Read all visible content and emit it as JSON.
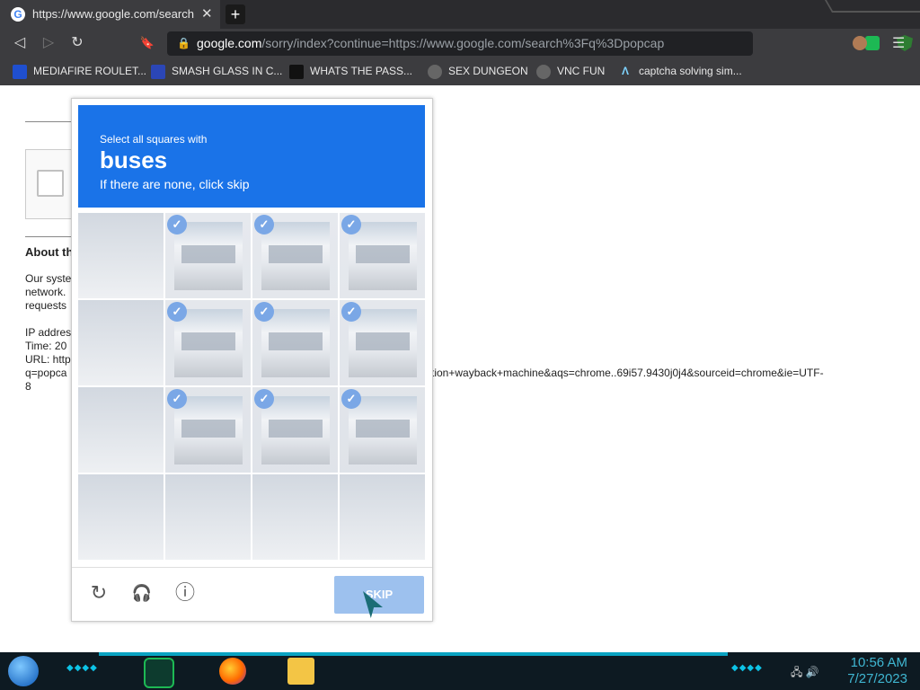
{
  "browser": {
    "tab": {
      "title": "https://www.google.com/search?q",
      "favicon": "G",
      "close": "✕"
    },
    "new_tab": "+",
    "toolbar": {
      "back": "◁",
      "forward": "▷",
      "reload": "↻",
      "bookmark": "🔖",
      "menu": "☰"
    },
    "omnibox": {
      "lock": "🔒",
      "host": "google.com",
      "path": "/sorry/index?continue=https://www.google.com/search%3Fq%3Dpopcap..."
    }
  },
  "bookmarks": [
    {
      "label": "MEDIAFIRE ROULET...",
      "icon": "mediafire-icon",
      "color": "#1f4fcf"
    },
    {
      "label": "SMASH GLASS IN C...",
      "icon": "smash-icon",
      "color": "#2b46b6"
    },
    {
      "label": "WHATS THE PASS...",
      "icon": "pass-icon",
      "color": "#111111"
    },
    {
      "label": "SEX DUNGEON",
      "icon": "dungeon-icon",
      "color": "#666666"
    },
    {
      "label": "VNC FUN",
      "icon": "vnc-icon",
      "color": "#666666"
    },
    {
      "label": "captcha solving sim...",
      "icon": "captcha-icon",
      "color": "#3c3c3f"
    }
  ],
  "page": {
    "heading": "About th",
    "para1": "Our syste\nnetwork.\nrequests",
    "para2": "IP addres\nTime: 20\nURL: http\nq=popca\n8",
    "url_tail": "tion+wayback+machine&aqs=chrome..69i57.9430j0j4&sourceid=chrome&ie=UTF-"
  },
  "captcha": {
    "header": {
      "instruction": "Select all squares with",
      "target": "buses",
      "hint": "If there are none, click skip"
    },
    "check_glyph": "✓",
    "tiles_selected": [
      false,
      true,
      true,
      true,
      false,
      true,
      true,
      true,
      false,
      true,
      true,
      true,
      false,
      false,
      false,
      false
    ],
    "footer": {
      "reload": "↻",
      "audio": "🎧",
      "info": "ⓘ",
      "skip_label": "SKIP"
    }
  },
  "taskbar": {
    "tray_icons": "🖧  🔊",
    "time": "10:56 AM",
    "date": "7/27/2023"
  }
}
